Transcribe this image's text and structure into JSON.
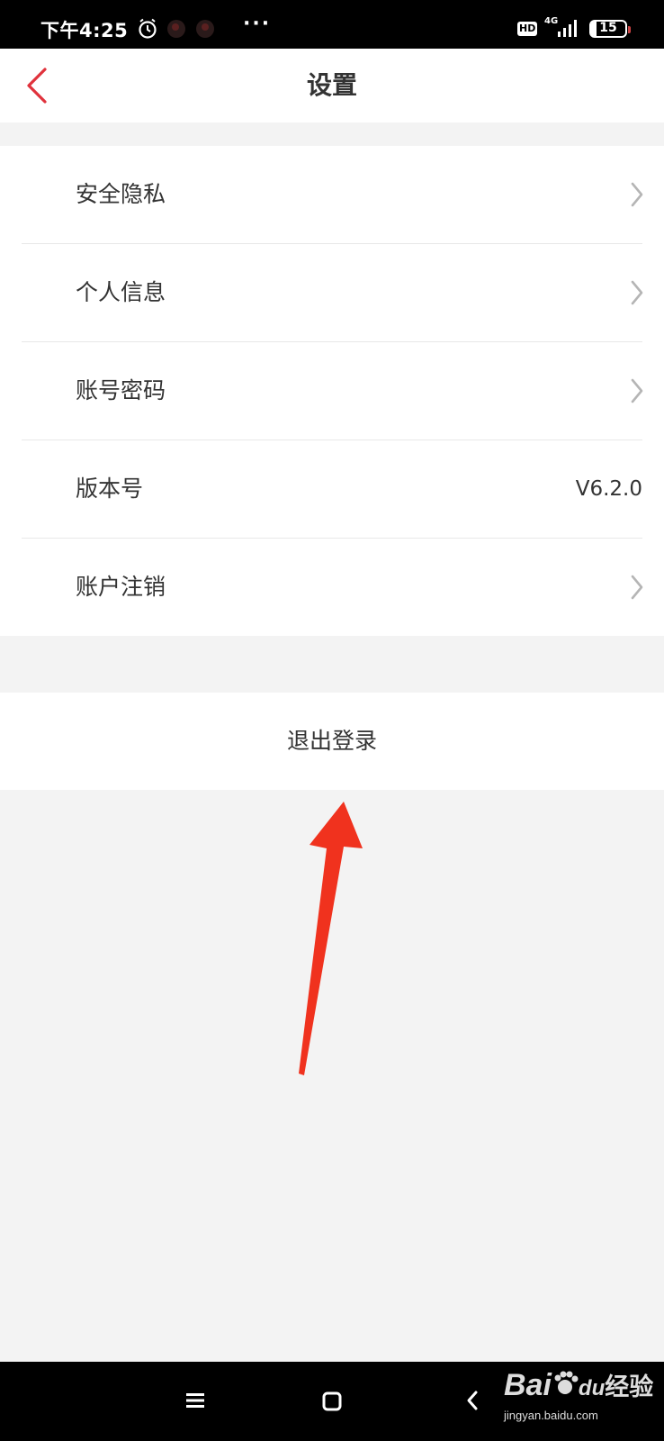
{
  "status_bar": {
    "time": "下午4:25",
    "more": "···",
    "hd": "HD",
    "network": "4G",
    "battery": "15",
    "battery_level_percent": 15
  },
  "header": {
    "title": "设置",
    "back_icon": "chevron-left-icon",
    "accent_color": "#e0323c"
  },
  "settings": {
    "items": [
      {
        "label": "安全隐私",
        "icon": "chevron-right-icon"
      },
      {
        "label": "个人信息",
        "icon": "chevron-right-icon"
      },
      {
        "label": "账号密码",
        "icon": "chevron-right-icon"
      },
      {
        "label": "版本号",
        "value": "V6.2.0"
      },
      {
        "label": "账户注销",
        "icon": "chevron-right-icon"
      }
    ]
  },
  "logout": {
    "label": "退出登录"
  },
  "annotation": {
    "arrow_color": "#f0321e"
  },
  "nav_bar": {
    "menu_icon": "menu-icon",
    "home_icon": "home-icon",
    "back_icon": "back-icon"
  },
  "watermark": {
    "brand": "Bai",
    "brand_suffix": "du",
    "label": "经验",
    "url": "jingyan.baidu.com"
  }
}
